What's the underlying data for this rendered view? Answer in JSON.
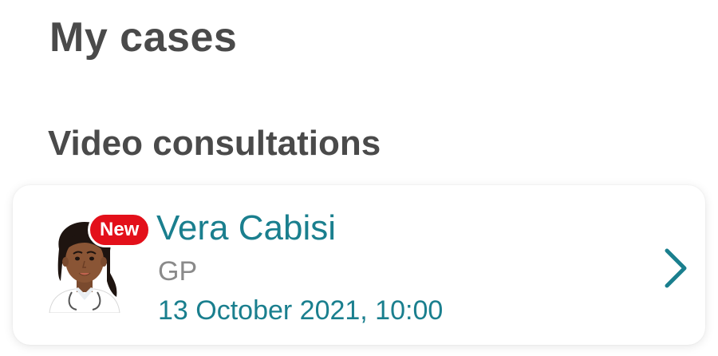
{
  "page": {
    "title": "My cases"
  },
  "section": {
    "title": "Video consultations"
  },
  "case": {
    "badge": "New",
    "name": "Vera Cabisi",
    "role": "GP",
    "datetime": "13 October 2021, 10:00",
    "avatar_icon": "doctor-avatar",
    "chevron_icon": "chevron-right-icon"
  },
  "colors": {
    "accent": "#1a7f8e",
    "badge": "#e3101a",
    "heading": "#4a4a4a",
    "secondary_text": "#8a8a8a"
  }
}
